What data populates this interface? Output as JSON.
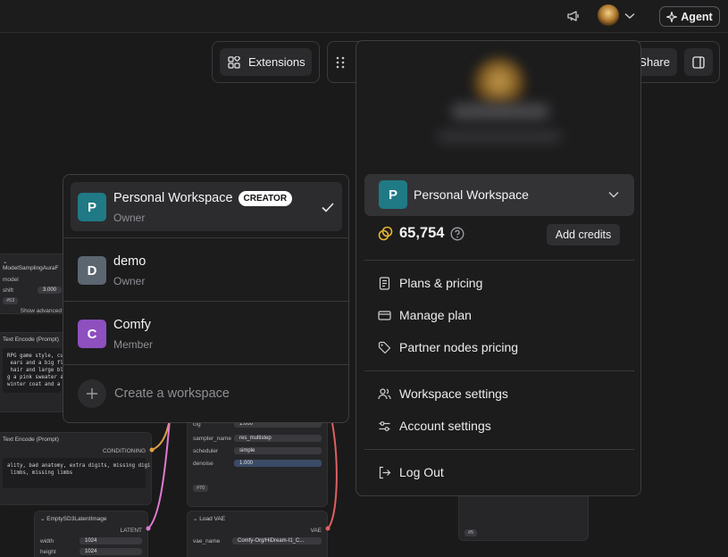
{
  "topbar": {
    "agent_label": "Agent",
    "icons": [
      "megaphone-icon",
      "user-avatar",
      "chevron-down-icon",
      "sparkle-icon"
    ]
  },
  "toolbar": {
    "extensions_label": "Extensions",
    "share_label": "Share"
  },
  "canvas_nodes": {
    "model_sampling": {
      "title": "ModelSamplingAuraF",
      "input_label": "model",
      "shift_label": "shift",
      "shift_value": "3.000",
      "tag": "#53",
      "show_advanced": "Show advanced"
    },
    "text_encode_positive": {
      "title": "Text Encode (Prompt)",
      "text": "RPG game style, cute anim\n ears and a big fluffy t\n hair and large blue eye\ng a pink sweater a large\nwinter coat and a long s"
    },
    "text_encode_negative": {
      "title": "Text Encode (Prompt)",
      "output": "CONDITIONING",
      "text": "ality, bad anatomy, extra digits, missing digits,\n limbs, missing limbs"
    },
    "empty_latent": {
      "title": "EmptySD3LatentImage",
      "output": "LATENT",
      "width_label": "width",
      "width_value": "1024",
      "height_label": "height",
      "height_value": "1024"
    },
    "ksampler": {
      "cfg_label": "cfg",
      "cfg_value": "1.000",
      "sampler_label": "sampler_name",
      "sampler_value": "res_multistep",
      "scheduler_label": "scheduler",
      "scheduler_value": "simple",
      "denoise_label": "denoise",
      "denoise_value": "1.000",
      "tag": "#70"
    },
    "load_vae": {
      "title": "Load VAE",
      "output": "VAE",
      "vae_label": "vae_name",
      "vae_value": "Comfy-Org/HiDream-I1_C..."
    },
    "right_node": {
      "tag": "#5"
    }
  },
  "workspace_switcher": {
    "workspaces": [
      {
        "initial": "P",
        "name": "Personal Workspace",
        "badge": "CREATOR",
        "role": "Owner",
        "color": "#1f7a85",
        "selected": true
      },
      {
        "initial": "D",
        "name": "demo",
        "role": "Owner",
        "color": "#5c6670",
        "selected": false
      },
      {
        "initial": "C",
        "name": "Comfy",
        "role": "Member",
        "color": "#8e4fbf",
        "selected": false
      }
    ],
    "create_label": "Create a workspace"
  },
  "account_menu": {
    "workspace_initial": "P",
    "workspace_name": "Personal Workspace",
    "workspace_color": "#1f7a85",
    "credits": "65,754",
    "add_credits_label": "Add credits",
    "items": {
      "plans": "Plans & pricing",
      "manage": "Manage plan",
      "partner": "Partner nodes pricing",
      "workspace_settings": "Workspace settings",
      "account_settings": "Account settings",
      "logout": "Log Out"
    }
  },
  "colors": {
    "background": "#1a1a1b",
    "popup": "#1c1c1d",
    "credit_icon": "#e8b530",
    "wire_orange": "#e0a040",
    "wire_pink": "#e07ad0",
    "wire_red": "#e06060"
  }
}
